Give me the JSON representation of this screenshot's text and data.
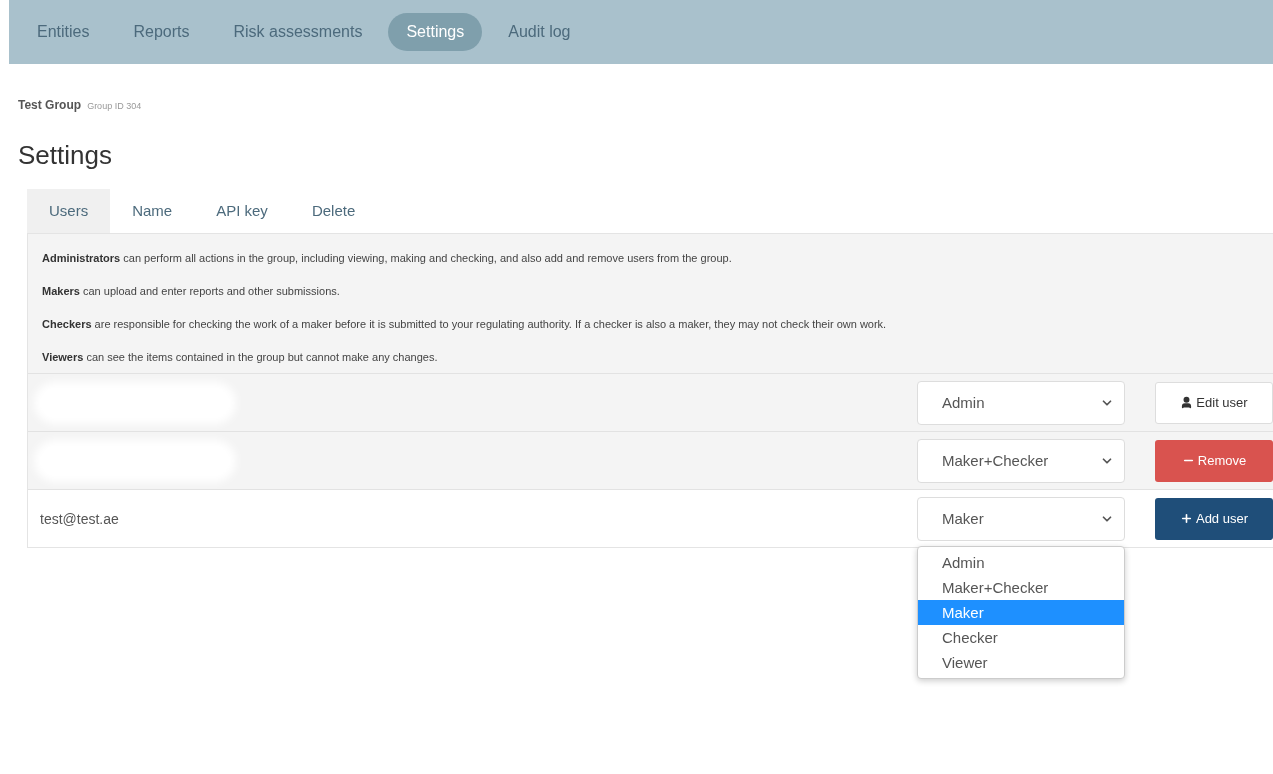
{
  "nav": [
    {
      "label": "Entities",
      "selected": false
    },
    {
      "label": "Reports",
      "selected": false
    },
    {
      "label": "Risk assessments",
      "selected": false
    },
    {
      "label": "Settings",
      "selected": true
    },
    {
      "label": "Audit log",
      "selected": false
    }
  ],
  "group": {
    "name": "Test Group",
    "id_label": "Group ID 304"
  },
  "heading": "Settings",
  "tabs": [
    {
      "label": "Users",
      "selected": true
    },
    {
      "label": "Name",
      "selected": false
    },
    {
      "label": "API key",
      "selected": false
    },
    {
      "label": "Delete",
      "selected": false
    }
  ],
  "descriptions": [
    "**Administrators** can perform all actions in the group, including viewing, making and checking, and also add and remove users from the group.",
    "**Makers** can upload and enter reports and other submissions.",
    "**Checkers** are responsible for checking the work of a maker before it is submitted to your regulating authority. If a checker is also a maker, they may not check their own work.",
    "**Viewers** can see the items contained in the group but cannot make any changes."
  ],
  "users": [
    {
      "kind": "redacted",
      "role": "Admin",
      "action": {
        "kind": "edit",
        "label": "Edit user"
      }
    },
    {
      "kind": "redacted",
      "role": "Maker+Checker",
      "action": {
        "kind": "remove",
        "label": "Remove"
      }
    },
    {
      "kind": "new",
      "email": "test@test.ae",
      "role": "Maker",
      "action": {
        "kind": "add",
        "label": "Add user"
      },
      "dropdown": [
        {
          "label": "Admin",
          "selected": false
        },
        {
          "label": "Maker+Checker",
          "selected": false
        },
        {
          "label": "Maker",
          "selected": true
        },
        {
          "label": "Checker",
          "selected": false
        },
        {
          "label": "Viewer",
          "selected": false
        }
      ]
    }
  ]
}
